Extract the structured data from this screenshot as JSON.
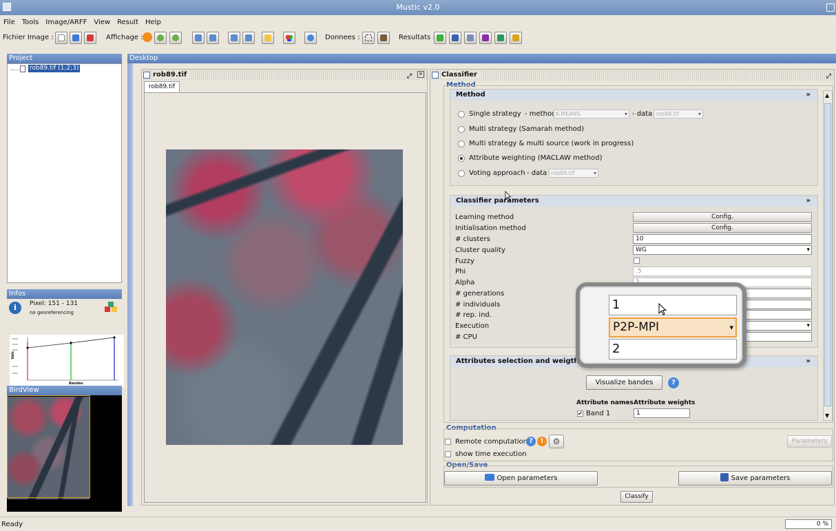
{
  "window": {
    "title": "Mustic v2.0"
  },
  "menu": [
    "File",
    "Tools",
    "Image/ARFF",
    "View",
    "Result",
    "Help"
  ],
  "toolbar": {
    "fichier_label": "Fichier Image :",
    "affichage_label": "Affichage :",
    "donnees_label": "Donnees :",
    "resultats_label": "Resultats :"
  },
  "project": {
    "title": "Project",
    "item": "rob89.tif (1;2;3)"
  },
  "infos": {
    "title": "Infos",
    "pixel": "Pixel: 151 - 131",
    "georef": "no georeferencing",
    "xlabel": "Bandes",
    "ylabel": "Vals"
  },
  "birdview": {
    "title": "BirdView"
  },
  "desktop": {
    "title": "Desktop"
  },
  "image_frame": {
    "title": "rob89.tif",
    "tab": "rob89.tif"
  },
  "classifier": {
    "title": "Classifier",
    "method_group": "Method",
    "method": {
      "title": "Method",
      "single": "Single strategy",
      "method_lbl": "- method",
      "method_val": "K-MEANS",
      "data_lbl": "- data",
      "data_val": "rob89.tif",
      "multi": "Multi strategy (Samarah method)",
      "multi_source": "Multi strategy & multi source (work in progress)",
      "attr_weight": "Attribute weighting (MACLAW method)",
      "voting": "Voting approach",
      "voting_data_lbl": "- data",
      "voting_data_val": "rob89.tif"
    },
    "params": {
      "title": "Classifier parameters",
      "learning": "Learning method",
      "learning_btn": "Config.",
      "init": "Initialisation method",
      "init_btn": "Config.",
      "clusters": "# clusters",
      "clusters_val": "10",
      "quality": "Cluster quality",
      "quality_val": "WG",
      "fuzzy": "Fuzzy",
      "phi": "Phi",
      "phi_val": ".5",
      "alpha": "Alpha",
      "alpha_val": "2",
      "generations": "# generations",
      "individuals": "# individuals",
      "rep": "# rep. ind.",
      "execution": "Execution",
      "cpu": "# CPU"
    },
    "attrs": {
      "title": "Attributes selection and weigths",
      "visualize": "Visualize bandes",
      "col_names": "Attribute names",
      "col_weights": "Attribute weights",
      "band1": "Band 1",
      "band1_weight": "1"
    },
    "computation": {
      "title": "Computation",
      "remote": "Remote computation",
      "time": "show time execution",
      "params_btn": "Parameters"
    },
    "opensave": {
      "title": "Open/Save",
      "open": "Open parameters",
      "save": "Save parameters"
    },
    "classify": "Classify"
  },
  "zoom": {
    "individuals": "1",
    "execution": "P2P-MPI",
    "cpu": "2"
  },
  "status": {
    "text": "Ready",
    "progress": "0 %",
    "progress_fraction": 0
  },
  "colors": {
    "accent": "#6d8fbd",
    "panel_head": "#5a7fb8"
  }
}
